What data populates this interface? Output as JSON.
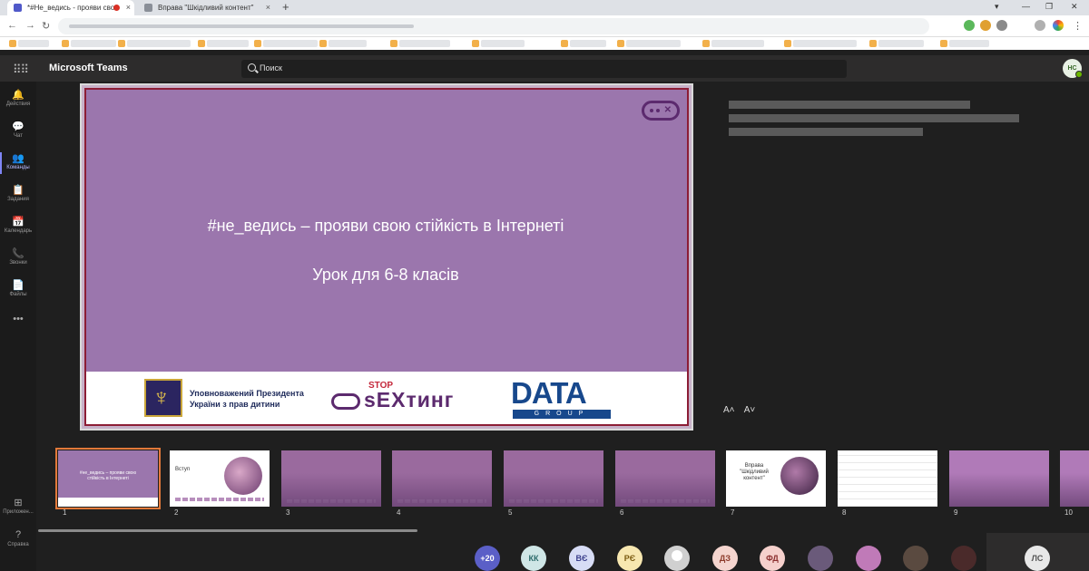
{
  "browser": {
    "tabs": [
      {
        "title": "*#Не_ведись - прояви сво",
        "active": true
      },
      {
        "title": "Вправа \"Шкідливий контент\"",
        "active": false
      }
    ],
    "new_tab": "+",
    "close": "×"
  },
  "teams": {
    "app_name": "Microsoft Teams",
    "search_placeholder": "Поиск",
    "user_initials": "НС",
    "rail": [
      {
        "icon": "bell-icon",
        "glyph": "🔔",
        "label": "Действия"
      },
      {
        "icon": "chat-icon",
        "glyph": "💬",
        "label": "Чат"
      },
      {
        "icon": "teams-icon",
        "glyph": "👥",
        "label": "Команды",
        "active": true
      },
      {
        "icon": "assignments-icon",
        "glyph": "📋",
        "label": "Задания"
      },
      {
        "icon": "calendar-icon",
        "glyph": "📅",
        "label": "Календарь"
      },
      {
        "icon": "calls-icon",
        "glyph": "📞",
        "label": "Звонки"
      },
      {
        "icon": "files-icon",
        "glyph": "📄",
        "label": "Файлы"
      },
      {
        "icon": "more-icon",
        "glyph": "•••",
        "label": ""
      }
    ],
    "rail_footer": [
      {
        "icon": "apps-icon",
        "glyph": "⊞",
        "label": "Приложен..."
      },
      {
        "icon": "help-icon",
        "glyph": "?",
        "label": "Справка"
      }
    ]
  },
  "slide": {
    "title": "#не_ведись – прояви свою стійкість в Інтернеті",
    "subtitle": "Урок для 6-8 класів",
    "ombudsman": "Уповноважений Президента України з прав дитини",
    "stop": "STOP",
    "sexting": "sEXтинг",
    "data_logo": "DATA",
    "data_group": "GROUP"
  },
  "font_controls": {
    "increase": "A˄",
    "decrease": "A˅"
  },
  "thumbnails": [
    {
      "num": "1",
      "style": "lav",
      "text": "#не_ведись – прояви свою стійкість в Інтернеті"
    },
    {
      "num": "2",
      "style": "white",
      "text": "Вступ"
    },
    {
      "num": "3",
      "style": "purple",
      "text": ""
    },
    {
      "num": "4",
      "style": "purple",
      "text": ""
    },
    {
      "num": "5",
      "style": "purple",
      "text": ""
    },
    {
      "num": "6",
      "style": "purple",
      "text": ""
    },
    {
      "num": "7",
      "style": "white",
      "text": "Вправа \"Шкідливий контент\""
    },
    {
      "num": "8",
      "style": "white",
      "text": ""
    },
    {
      "num": "9",
      "style": "purple",
      "text": ""
    },
    {
      "num": "10",
      "style": "purple",
      "text": ""
    }
  ],
  "participants": [
    {
      "initials": "+20",
      "bg": "#5b5fc7",
      "fg": "#ffffff"
    },
    {
      "initials": "КК",
      "bg": "#cfe6e6",
      "fg": "#2a6a6a"
    },
    {
      "initials": "ВЄ",
      "bg": "#d7dcf5",
      "fg": "#3b3f8c"
    },
    {
      "initials": "РЄ",
      "bg": "#f7e7b0",
      "fg": "#7a5a10"
    },
    {
      "initials": "",
      "bg": "#d0d0d0",
      "fg": "#666666"
    },
    {
      "initials": "ДЗ",
      "bg": "#f5d5cf",
      "fg": "#8c3a2a"
    },
    {
      "initials": "ФД",
      "bg": "#f5d0cc",
      "fg": "#8c3030"
    },
    {
      "initials": "",
      "bg": "#6a5a7a",
      "fg": "#ffffff"
    },
    {
      "initials": "",
      "bg": "#c07ab8",
      "fg": "#ffffff"
    },
    {
      "initials": "",
      "bg": "#5a4a40",
      "fg": "#ffffff"
    },
    {
      "initials": "",
      "bg": "#4a2a2a",
      "fg": "#ffffff"
    }
  ],
  "self_initials": "ЛС"
}
